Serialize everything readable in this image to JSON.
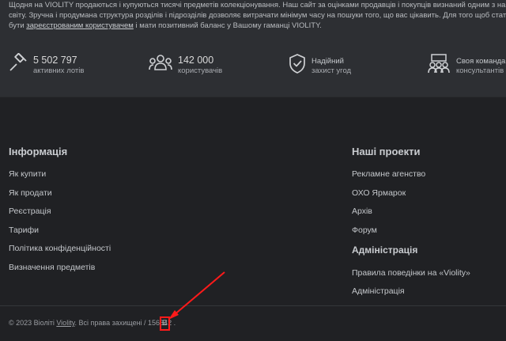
{
  "intro": {
    "line1": "Щодня на VIOLITY продаються і купуються тисячі предметів колекціонування. Наш сайт за оцінками продавців і покупців визнаний одним з найбільш зр",
    "line2": "світу. Зручна і продумана структура розділів і підрозділів дозволяє витрачати мінімум часу на пошуки того, що вас цікавить. Для того щоб стати учасни",
    "line3_pre": "бути ",
    "line3_link": "зареєстрованим користувачем",
    "line3_post": " і мати позитивний баланс у Вашому гаманці VIOLITY."
  },
  "stats": [
    {
      "icon": "gavel-icon",
      "value": "5 502 797",
      "label": "активних лотів"
    },
    {
      "icon": "users-icon",
      "value": "142 000",
      "label": "користувачів"
    },
    {
      "icon": "shield-check-icon",
      "value": "Надійний",
      "label": "захист угод"
    },
    {
      "icon": "team-icon",
      "value": "Своя команда",
      "label": "консультантів"
    }
  ],
  "info": {
    "title": "Інформація",
    "links": [
      "Як купити",
      "Як продати",
      "Реєстрація",
      "Тарифи",
      "Політика конфіденційності",
      "Визначення предметів"
    ]
  },
  "projects": {
    "title": "Наші проекти",
    "links": [
      "Рекламне агенство",
      "ОХО Ярмарок",
      "Архів",
      "Форум"
    ]
  },
  "admin": {
    "title": "Адміністрація",
    "links": [
      "Правила поведінки на «Violity»",
      "Адміністрація"
    ]
  },
  "footer": {
    "copy_pre": "© 2023 Віоліті ",
    "copy_link": "Violity",
    "copy_post": ". Всі права захищені / 156642 .",
    "code": "E"
  },
  "colors": {
    "annotation": "#ff1a1a"
  }
}
